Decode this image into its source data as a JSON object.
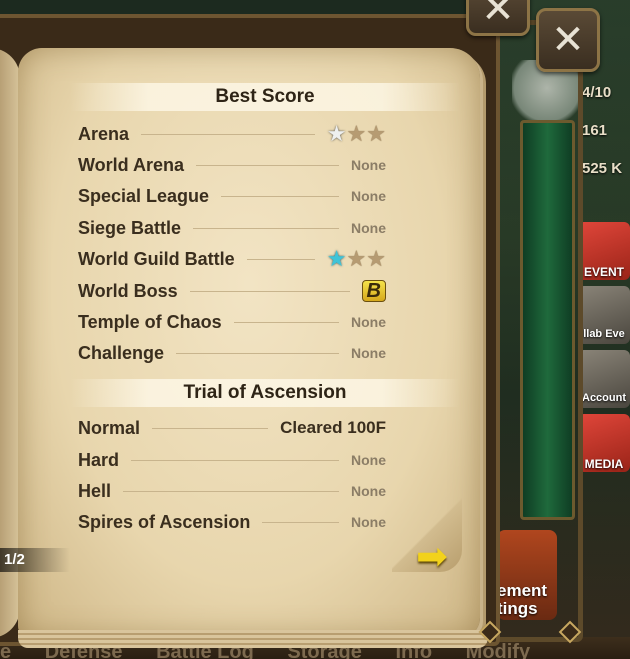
{
  "background": {
    "bottom_tabs": [
      "e",
      "Defense",
      "Battle Log",
      "Storage",
      "Info",
      "Modify"
    ],
    "side_numbers": [
      "4/10",
      "161",
      "525 K"
    ],
    "side_icons": [
      "EVENT",
      "llab Eve",
      "Account\nmited Pa",
      "MEDIA"
    ],
    "management_button": "ement\ntings"
  },
  "book": {
    "best_score": {
      "title": "Best Score",
      "rows": [
        {
          "label": "Arena",
          "value": "",
          "stars": "silver"
        },
        {
          "label": "World Arena",
          "value": "None"
        },
        {
          "label": "Special League",
          "value": "None"
        },
        {
          "label": "Siege Battle",
          "value": "None"
        },
        {
          "label": "World Guild Battle",
          "value": "",
          "stars": "blue"
        },
        {
          "label": "World Boss",
          "value": "B"
        },
        {
          "label": "Temple of Chaos",
          "value": "None"
        },
        {
          "label": "Challenge",
          "value": "None"
        }
      ]
    },
    "trial": {
      "title": "Trial of Ascension",
      "rows": [
        {
          "label": "Normal",
          "value": "Cleared 100F"
        },
        {
          "label": "Hard",
          "value": "None"
        },
        {
          "label": "Hell",
          "value": "None"
        },
        {
          "label": "Spires of Ascension",
          "value": "None"
        }
      ]
    },
    "page_indicator": "1/2"
  },
  "icons": {
    "close": "close-icon",
    "next": "arrow-right-icon",
    "star": "star-icon"
  },
  "colors": {
    "page": "#efe0bd",
    "star_silver": "#eef0f0",
    "star_blue": "#3fc4d8",
    "badge": "#f5e24a",
    "arrow": "#f2d21c"
  }
}
